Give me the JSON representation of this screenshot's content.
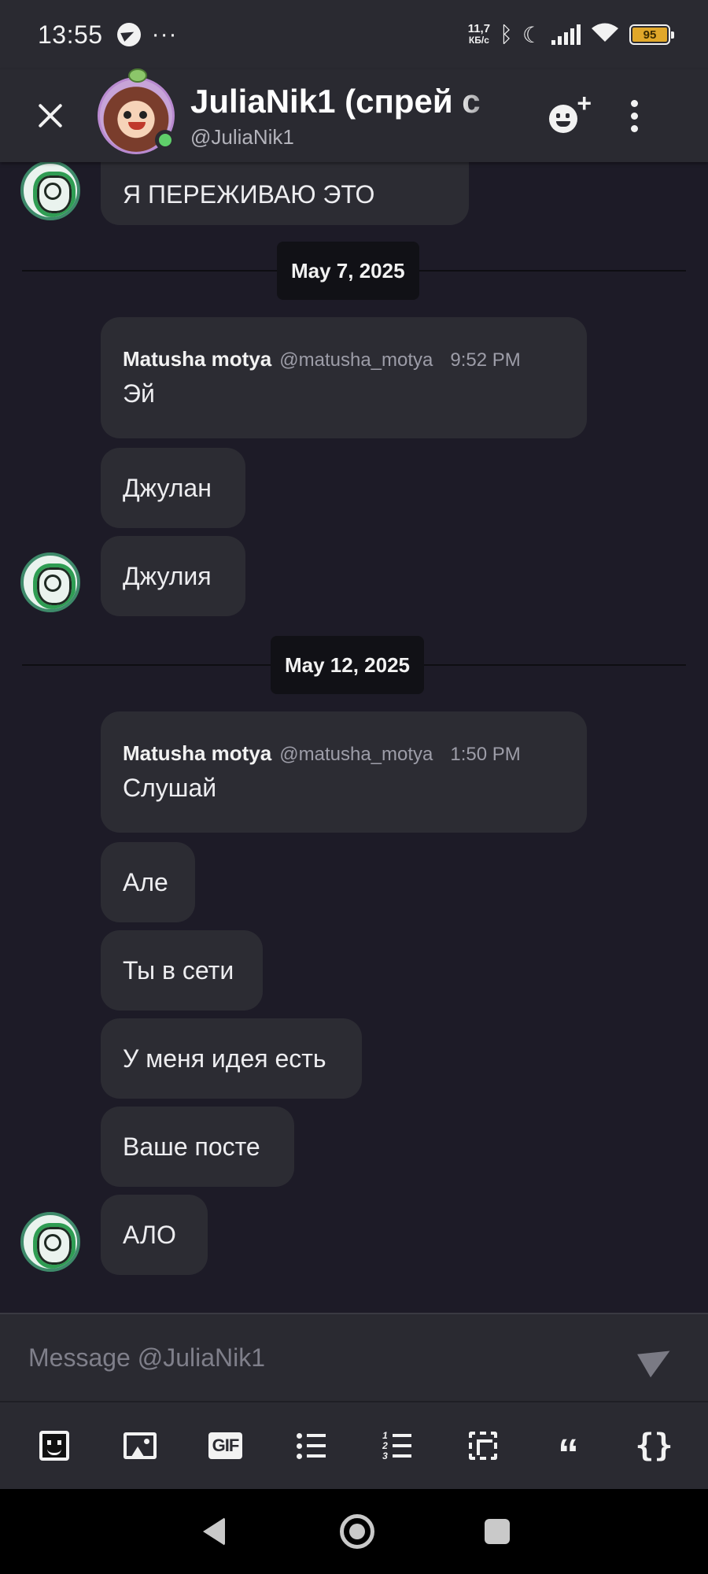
{
  "status_bar": {
    "time": "13:55",
    "dots": "···",
    "speed_value": "11,7",
    "speed_unit": "КБ/с",
    "battery": "95"
  },
  "header": {
    "title": "JuliaNik1 (спрей с",
    "handle": "@JuliaNik1"
  },
  "messages": {
    "m0": {
      "text": "Я ПЕРЕЖИВАЮ ЭТО"
    },
    "date1": "May 7, 2025",
    "m1": {
      "author": "Matusha motya",
      "handle": "@matusha_motya",
      "time": "9:52 PM",
      "text": "Эй"
    },
    "m2": {
      "text": "Джулан"
    },
    "m3": {
      "text": "Джулия"
    },
    "date2": "May 12, 2025",
    "m4": {
      "author": "Matusha motya",
      "handle": "@matusha_motya",
      "time": "1:50 PM",
      "text": "Слушай"
    },
    "m5": {
      "text": "Але"
    },
    "m6": {
      "text": "Ты в сети"
    },
    "m7": {
      "text": "У меня идея есть"
    },
    "m8": {
      "text": "Ваше посте"
    },
    "m9": {
      "text": "АЛО"
    }
  },
  "composer": {
    "placeholder": "Message @JuliaNik1"
  },
  "toolbar": {
    "gif_label": "GIF",
    "quote_glyph": "“",
    "code_glyph": "{}",
    "olist_numbers": [
      "1",
      "2",
      "3"
    ]
  },
  "colors": {
    "background": "#1d1b27",
    "bubble": "#2c2c33",
    "presence_online": "#5fcf6a",
    "battery": "#e0a72a"
  }
}
